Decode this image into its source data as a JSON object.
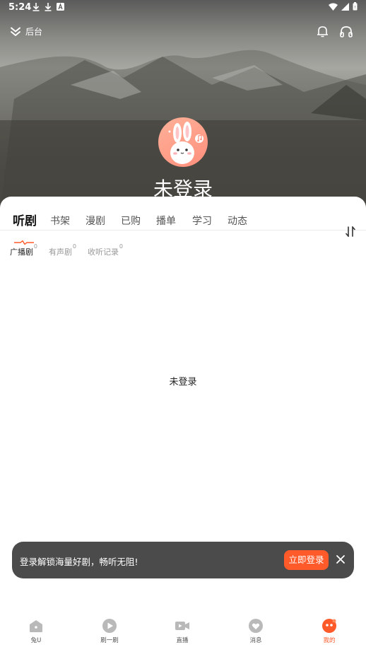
{
  "status_bar": {
    "time": "5:24"
  },
  "header": {
    "back_label": "后台",
    "username": "未登录"
  },
  "tabs": [
    {
      "label": "听剧",
      "active": true
    },
    {
      "label": "书架"
    },
    {
      "label": "漫剧"
    },
    {
      "label": "已购"
    },
    {
      "label": "播单"
    },
    {
      "label": "学习"
    },
    {
      "label": "动态"
    }
  ],
  "subtabs": [
    {
      "label": "广播剧",
      "count": "0",
      "active": true
    },
    {
      "label": "有声剧",
      "count": "0"
    },
    {
      "label": "收听记录",
      "count": "0"
    }
  ],
  "content": {
    "empty_text": "未登录"
  },
  "login_banner": {
    "text": "登录解锁海量好剧，畅听无阻!",
    "button_label": "立即登录"
  },
  "bottom_nav": [
    {
      "label": "兔U",
      "icon": "house-icon"
    },
    {
      "label": "刷一刷",
      "icon": "play-circle-icon"
    },
    {
      "label": "直播",
      "icon": "video-camera-icon"
    },
    {
      "label": "消息",
      "icon": "heart-bubble-icon"
    },
    {
      "label": "我的",
      "icon": "profile-face-icon",
      "active": true
    }
  ],
  "colors": {
    "accent": "#ff5a2a",
    "banner_bg": "#4b4b4b",
    "avatar_bg": "#ff9f88"
  }
}
